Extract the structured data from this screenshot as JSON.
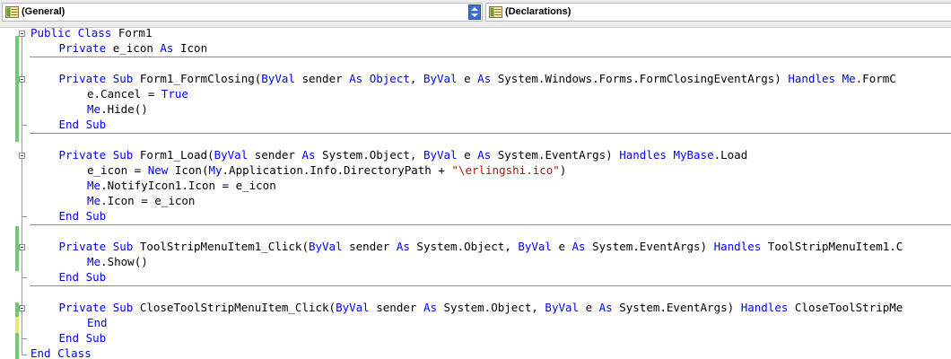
{
  "toolbar": {
    "object_combo": "(General)",
    "procedure_combo": "(Declarations)"
  },
  "code": {
    "lines": [
      [
        [
          "kw",
          "Public Class"
        ],
        [
          "p",
          " Form1"
        ]
      ],
      [
        [
          "kw",
          "Private"
        ],
        [
          "p",
          " e_icon "
        ],
        [
          "kw",
          "As"
        ],
        [
          "p",
          " Icon"
        ]
      ],
      [],
      [
        [
          "kw",
          "Private Sub"
        ],
        [
          "p",
          " Form1_FormClosing("
        ],
        [
          "kw",
          "ByVal"
        ],
        [
          "p",
          " sender "
        ],
        [
          "kw",
          "As Object"
        ],
        [
          "p",
          ", "
        ],
        [
          "kw",
          "ByVal"
        ],
        [
          "p",
          " e "
        ],
        [
          "kw",
          "As"
        ],
        [
          "p",
          " System.Windows.Forms.FormClosingEventArgs) "
        ],
        [
          "kw",
          "Handles Me"
        ],
        [
          "p",
          ".FormC"
        ]
      ],
      [
        [
          "p",
          "e.Cancel = "
        ],
        [
          "kw",
          "True"
        ]
      ],
      [
        [
          "kw",
          "Me"
        ],
        [
          "p",
          ".Hide()"
        ]
      ],
      [
        [
          "kw",
          "End Sub"
        ]
      ],
      [],
      [
        [
          "kw",
          "Private Sub"
        ],
        [
          "p",
          " Form1_Load("
        ],
        [
          "kw",
          "ByVal"
        ],
        [
          "p",
          " sender "
        ],
        [
          "kw",
          "As"
        ],
        [
          "p",
          " System.Object, "
        ],
        [
          "kw",
          "ByVal"
        ],
        [
          "p",
          " e "
        ],
        [
          "kw",
          "As"
        ],
        [
          "p",
          " System.EventArgs) "
        ],
        [
          "kw",
          "Handles MyBase"
        ],
        [
          "p",
          ".Load"
        ]
      ],
      [
        [
          "p",
          "e_icon = "
        ],
        [
          "kw",
          "New"
        ],
        [
          "p",
          " Icon("
        ],
        [
          "kw",
          "My"
        ],
        [
          "p",
          ".Application.Info.DirectoryPath + "
        ],
        [
          "str",
          "\"\\erlingshi.ico\""
        ],
        [
          "p",
          ")"
        ]
      ],
      [
        [
          "kw",
          "Me"
        ],
        [
          "p",
          ".NotifyIcon1.Icon = e_icon"
        ]
      ],
      [
        [
          "kw",
          "Me"
        ],
        [
          "p",
          ".Icon = e_icon"
        ]
      ],
      [
        [
          "kw",
          "End Sub"
        ]
      ],
      [],
      [
        [
          "kw",
          "Private Sub"
        ],
        [
          "p",
          " ToolStripMenuItem1_Click("
        ],
        [
          "kw",
          "ByVal"
        ],
        [
          "p",
          " sender "
        ],
        [
          "kw",
          "As"
        ],
        [
          "p",
          " System.Object, "
        ],
        [
          "kw",
          "ByVal"
        ],
        [
          "p",
          " e "
        ],
        [
          "kw",
          "As"
        ],
        [
          "p",
          " System.EventArgs) "
        ],
        [
          "kw",
          "Handles"
        ],
        [
          "p",
          " ToolStripMenuItem1.C"
        ]
      ],
      [
        [
          "kw",
          "Me"
        ],
        [
          "p",
          ".Show()"
        ]
      ],
      [
        [
          "kw",
          "End Sub"
        ]
      ],
      [],
      [
        [
          "kw",
          "Private Sub"
        ],
        [
          "p",
          " CloseToolStripMenuItem_Click("
        ],
        [
          "kw",
          "ByVal"
        ],
        [
          "p",
          " sender "
        ],
        [
          "kw",
          "As"
        ],
        [
          "p",
          " System.Object, "
        ],
        [
          "kw",
          "ByVal"
        ],
        [
          "p",
          " e "
        ],
        [
          "kw",
          "As"
        ],
        [
          "p",
          " System.EventArgs) "
        ],
        [
          "kw",
          "Handles"
        ],
        [
          "p",
          " CloseToolStripMe"
        ]
      ],
      [
        [
          "kw",
          "End"
        ]
      ],
      [
        [
          "kw",
          "End Sub"
        ]
      ],
      [
        [
          "kw",
          "End Class"
        ]
      ]
    ]
  },
  "colors": {
    "keyword": "#0000ff",
    "string": "#a31515",
    "text": "#000000",
    "changed_saved": "#6ccd6c",
    "changed_unsaved": "#f1e66d"
  },
  "icons": {
    "combo_left": "class-icon",
    "combo_right": "declarations-icon",
    "combo_arrow": "spin-arrows-icon"
  }
}
